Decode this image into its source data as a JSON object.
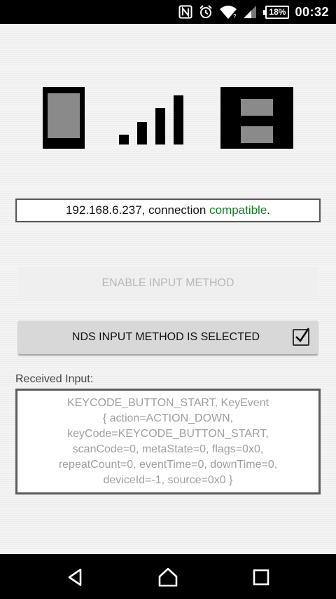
{
  "status_bar": {
    "icons": [
      "nfc-icon",
      "alarm-icon",
      "wifi-icon",
      "cell-signal-icon"
    ],
    "battery": "18%",
    "time": "00:32"
  },
  "hero_icons": [
    "phone-icon",
    "signal-strength-icon",
    "nintendo-ds-icon"
  ],
  "connection": {
    "prefix": "192.168.6.237, connection ",
    "status": "compatible",
    "suffix": ".",
    "status_color": "#1a7a2a"
  },
  "buttons": {
    "enable_label": "ENABLE INPUT METHOD",
    "selected_label": "NDS INPUT METHOD IS SELECTED",
    "selected_checked": true
  },
  "received": {
    "label": "Received Input:",
    "text": "KEYCODE_BUTTON_START, KeyEvent\n{ action=ACTION_DOWN,\nkeyCode=KEYCODE_BUTTON_START,\nscanCode=0, metaState=0, flags=0x0,\nrepeatCount=0, eventTime=0, downTime=0,\ndeviceId=-1, source=0x0 }"
  },
  "nav_bar": {
    "icons": [
      "back-icon",
      "home-icon",
      "recents-icon"
    ]
  }
}
